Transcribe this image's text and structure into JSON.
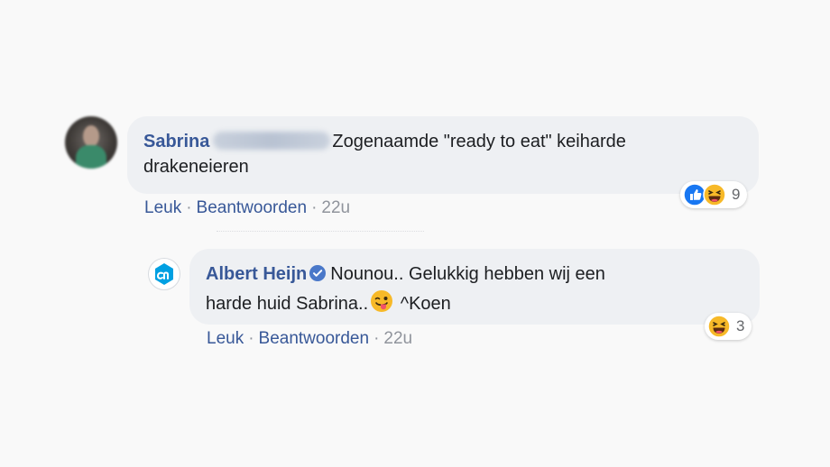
{
  "comments": [
    {
      "author": "Sabrina",
      "text": "Zogenaamde \"ready to eat\" keiharde drakeneieren",
      "line1": "Zogenaamde \"ready to eat\" keiharde",
      "line2": "drakeneieren",
      "reaction_icons": [
        "like-icon",
        "haha-icon"
      ],
      "reaction_count": "9",
      "actions": {
        "like": "Leuk",
        "reply": "Beantwoorden",
        "time": "22u"
      }
    },
    {
      "author": "Albert Heijn",
      "verified": true,
      "line1": "Nounou.. Gelukkig hebben wij een",
      "line2a": "harde huid Sabrina..",
      "line2b": "^Koen",
      "reaction_icons": [
        "haha-icon"
      ],
      "reaction_count": "3",
      "actions": {
        "like": "Leuk",
        "reply": "Beantwoorden",
        "time": "22u"
      }
    }
  ],
  "colors": {
    "bubble": "#eef0f3",
    "author": "#385898",
    "link": "#385898",
    "meta": "#90949c",
    "like_blue": "#1877f2",
    "haha_yellow": "#f7b928",
    "ah_blue": "#00a0e2"
  }
}
